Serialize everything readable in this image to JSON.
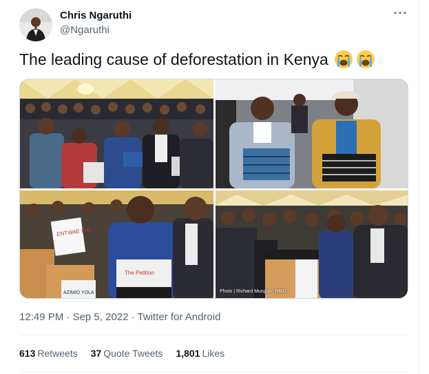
{
  "author": {
    "name": "Chris Ngaruthi",
    "handle": "@Ngaruthi"
  },
  "more_label": "···",
  "tweet": {
    "text": "The leading cause of deforestation in Kenya",
    "emojis": [
      "loudly-crying-face",
      "loudly-crying-face"
    ]
  },
  "media": {
    "photo_credit": "Photo | Richard Munguti | NMG",
    "box_labels": {
      "p3_box_a": "ENTWAE PIO",
      "p3_box_b": "The Petition",
      "p3_box_c": "AZIMIO YOLA"
    }
  },
  "meta": {
    "time": "12:49 PM",
    "separator": "·",
    "date": "Sep 5, 2022",
    "source": "Twitter for Android"
  },
  "stats": [
    {
      "count": "613",
      "label": "Retweets"
    },
    {
      "count": "37",
      "label": "Quote Tweets"
    },
    {
      "count": "1,801",
      "label": "Likes"
    }
  ],
  "colors": {
    "text_primary": "#0f1419",
    "text_secondary": "#536471",
    "divider": "#eff3f4"
  }
}
